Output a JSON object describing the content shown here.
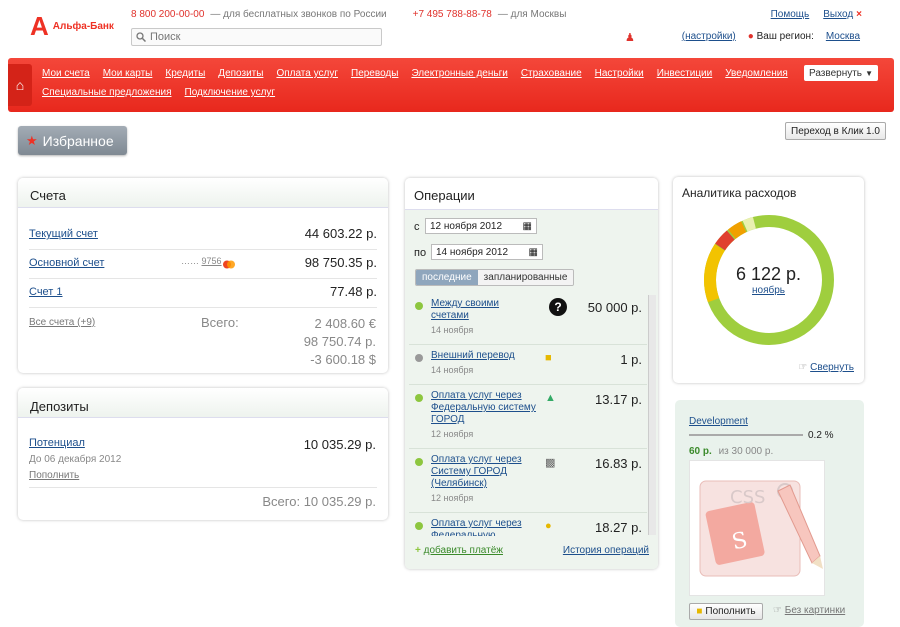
{
  "header": {
    "logo_text": "Альфа-Банк",
    "phone1": "8 800 200-00-00",
    "phone1_note": "— для бесплатных звонков по России",
    "phone2": "+7 495 788-88-78",
    "phone2_note": "— для Москвы",
    "search_placeholder": "Поиск",
    "help": "Помощь",
    "logout": "Выход",
    "settings": "(настройки)",
    "region_label": "Ваш регион:",
    "region_value": "Москва"
  },
  "nav": {
    "row1": [
      "Мои счета",
      "Мои карты",
      "Кредиты",
      "Депозиты",
      "Оплата услуг",
      "Переводы",
      "Электронные деньги",
      "Страхование",
      "Настройки",
      "Инвестиции",
      "Уведомления"
    ],
    "row2": [
      "Специальные предложения",
      "Подключение услуг"
    ],
    "expand": "Развернуть"
  },
  "favorites": "Избранное",
  "klik_button": "Переход в Клик 1.0",
  "accounts": {
    "title": "Счета",
    "items": [
      {
        "name": "Текущий счет",
        "amount": "44 603.22 р."
      },
      {
        "name": "Основной счет",
        "card": "9756",
        "amount": "98 750.35 р."
      },
      {
        "name": "Счет 1",
        "amount": "77.48 р."
      }
    ],
    "all_link": "Все счета (+9)",
    "total_label": "Всего:",
    "totals": [
      "2 408.60 €",
      "98 750.74 р.",
      "-3 600.18 $"
    ]
  },
  "deposits": {
    "title": "Депозиты",
    "name": "Потенциал",
    "until": "До 06 декабря 2012",
    "amount": "10 035.29 р.",
    "topup": "Пополнить",
    "total": "Всего: 10 035.29 р."
  },
  "operations": {
    "title": "Операции",
    "from_label": "с",
    "from_date": "12 ноября 2012",
    "to_label": "по",
    "to_date": "14 ноября 2012",
    "tab_recent": "последние",
    "tab_planned": "запланированные",
    "items": [
      {
        "title": "Между своими счетами",
        "date": "14 ноября",
        "amount": "50 000 р."
      },
      {
        "title": "Внешний перевод",
        "date": "14 ноября",
        "amount": "1 р."
      },
      {
        "title": "Оплата услуг через Федеральную систему ГОРОД",
        "date": "12 ноября",
        "amount": "13.17 р."
      },
      {
        "title": "Оплата услуг через Систему ГОРОД (Челябинск)",
        "date": "12 ноября",
        "amount": "16.83 р."
      },
      {
        "title": "Оплата услуг через Федеральную",
        "date": "",
        "amount": "18.27 р."
      }
    ],
    "add_payment": "добавить платёж",
    "history": "История операций"
  },
  "analytics": {
    "title": "Аналитика расходов",
    "amount": "6 122 р.",
    "month": "ноябрь",
    "collapse": "Свернуть"
  },
  "development": {
    "title": "Development",
    "percent": "0.2 %",
    "saved": "60 р.",
    "of_label": "из 30 000 р.",
    "topup": "Пополнить",
    "no_image": "Без картинки"
  }
}
